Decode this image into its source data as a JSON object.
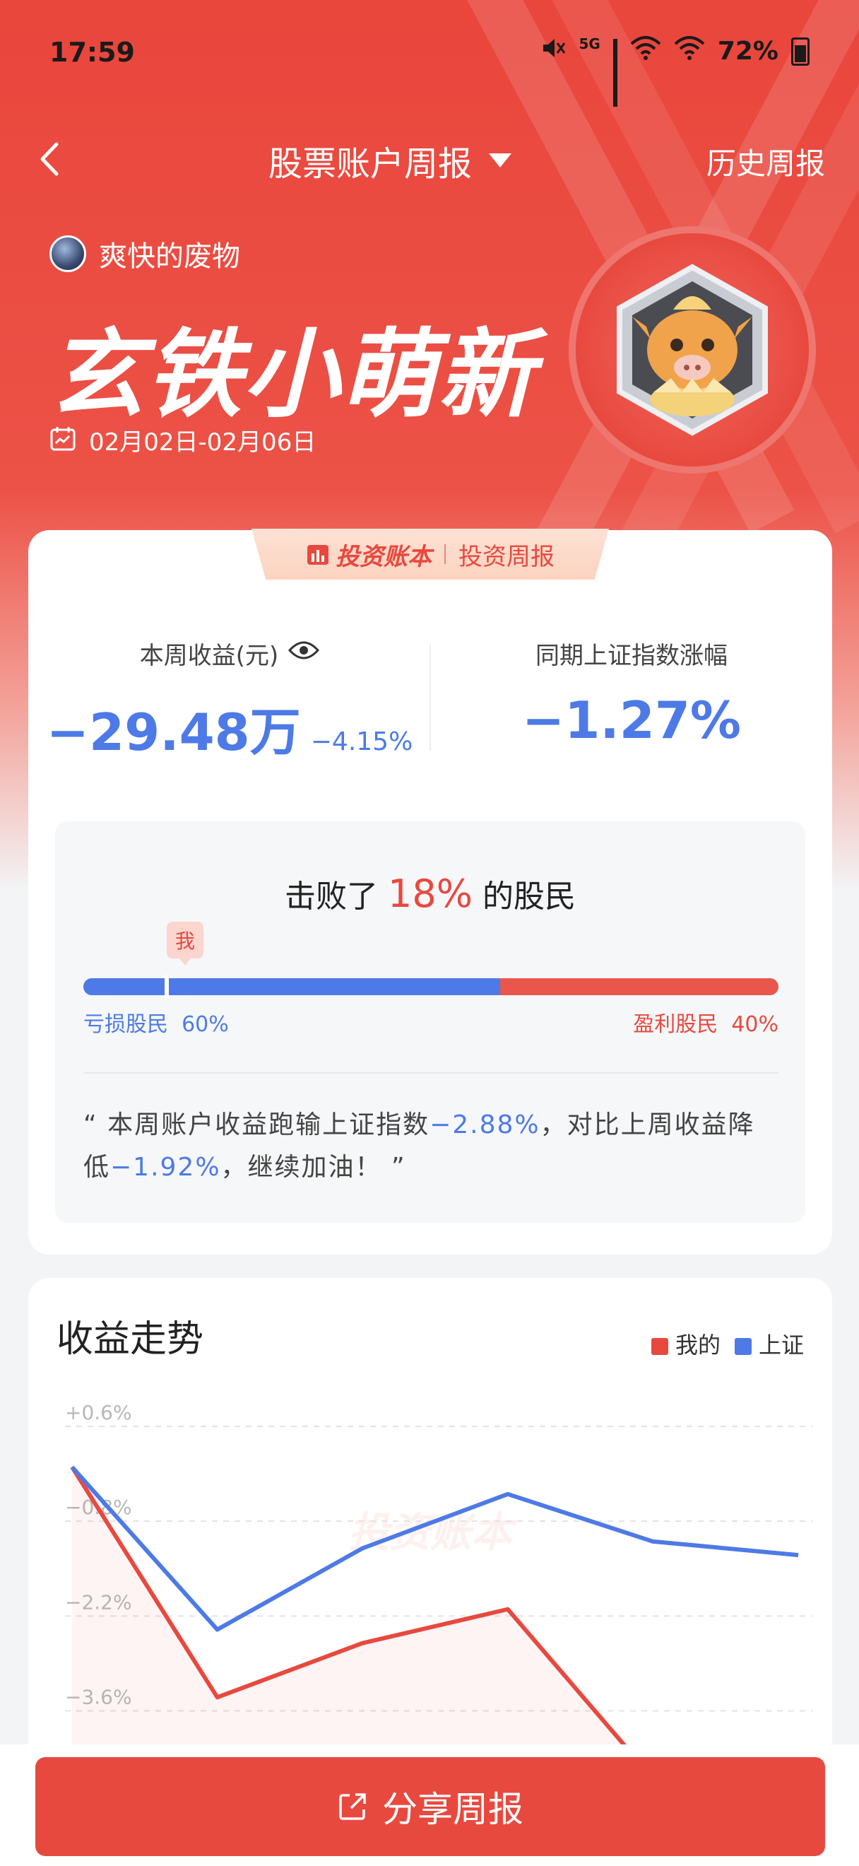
{
  "status_bar": {
    "time": "17:59",
    "network": "5G",
    "battery": "72%"
  },
  "nav": {
    "title": "股票账户周报",
    "history": "历史周报"
  },
  "user": {
    "name": "爽快的废物"
  },
  "badge": {
    "title": "玄铁小萌新"
  },
  "date_range": "02月02日-02月06日",
  "report_tab": {
    "brand": "投资账本",
    "label": "投资周报"
  },
  "stats": {
    "weekly_profit_label": "本周收益(元)",
    "weekly_profit_value": "−29.48万",
    "weekly_profit_pct": "−4.15%",
    "index_label": "同期上证指数涨幅",
    "index_value": "−1.27%"
  },
  "beat": {
    "prefix": "击败了",
    "pct": "18%",
    "suffix": "的股民",
    "me_tag": "我",
    "loss_label": "亏损股民",
    "loss_pct": "60%",
    "gain_label": "盈利股民",
    "gain_pct": "40%",
    "loss_fraction": 0.6,
    "me_fraction": 0.16,
    "quote_part1": "“ 本周账户收益跑输上证指数",
    "quote_val1": "−2.88%",
    "quote_part2": "，对比上周收益降低",
    "quote_val2": "−1.92%",
    "quote_part3": "，继续加油！ ”"
  },
  "trend": {
    "title": "收益走势",
    "legend_mine": "我的",
    "legend_index": "上证",
    "watermark": "投资账本"
  },
  "colors": {
    "mine": "#e8493f",
    "index": "#4d7ae6"
  },
  "chart_data": {
    "type": "line",
    "title": "收益走势",
    "y_ticks": [
      "+0.6%",
      "−0.8%",
      "−2.2%",
      "−3.6%"
    ],
    "ylim": [
      -4.2,
      0.6
    ],
    "x": [
      0,
      1,
      2,
      3,
      4,
      5
    ],
    "series": [
      {
        "name": "我的",
        "values": [
          -0.0,
          -3.4,
          -2.6,
          -2.1,
          -4.6,
          null
        ]
      },
      {
        "name": "上证",
        "values": [
          -0.0,
          -2.4,
          -1.2,
          -0.4,
          -1.1,
          -1.3
        ]
      }
    ]
  },
  "share": {
    "label": "分享周报"
  }
}
